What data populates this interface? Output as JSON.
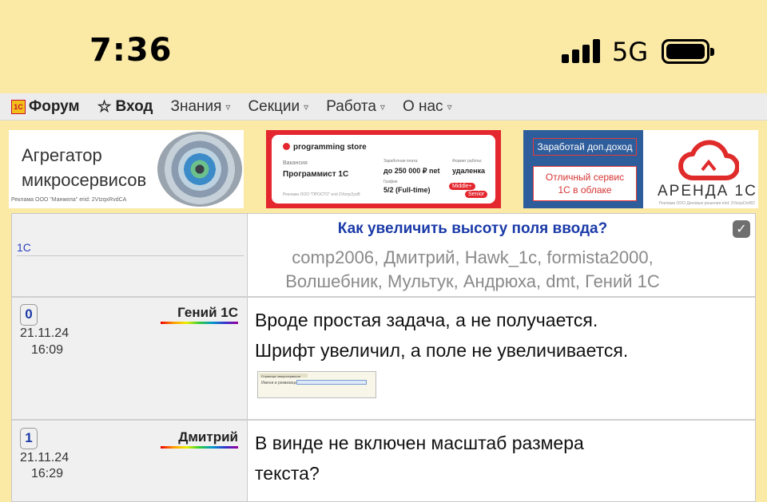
{
  "status_bar": {
    "time": "7:36",
    "network": "5G"
  },
  "nav": {
    "items": [
      {
        "label": "Форум",
        "icon": "1c-logo-icon"
      },
      {
        "label": "Вход",
        "icon": "star-icon"
      },
      {
        "label": "Знания",
        "icon": "caret-down-icon"
      },
      {
        "label": "Секции",
        "icon": "caret-down-icon"
      },
      {
        "label": "Работа",
        "icon": "caret-down-icon"
      },
      {
        "label": "О нас",
        "icon": "caret-down-icon"
      }
    ],
    "caret": "▿"
  },
  "ads": {
    "ad1": {
      "line1": "Агрегатор",
      "line2": "микросервисов",
      "disclaimer": "Реклама ООО \"Манжела\"    erid: 2VtzqxRvdCA"
    },
    "ad2": {
      "store": "programming store",
      "vacancy_label": "Вакансия",
      "vacancy": "Программист 1С",
      "salary_label": "Заработная плата:",
      "salary": "до 250 000 ₽ net",
      "format_label": "Формат работы:",
      "format": "удаленка",
      "schedule_label": "График:",
      "schedule": "5/2 (Full-time)",
      "tag1": "Middle+",
      "tag2": "Senior",
      "disclaimer": "Реклама ООО \"ПРОСТО\" erid 2Vtzqv2yoB"
    },
    "ad3": {
      "button1": "Заработай доп.доход",
      "button2_line1": "Отличный сервис",
      "button2_line2": "1С в облаке",
      "brand": "АРЕНДА 1С",
      "disclaimer": "Реклама ООО Деловые решения erid: 2VtzqvDctRD"
    }
  },
  "topic": {
    "section": "1С",
    "title": "Как увеличить высоту поля ввода?",
    "participants_line1": "comp2006, Дмитрий, Hawk_1c, formista2000,",
    "participants_line2": "Волшебник, Мультук, Андрюха, dmt, Гений 1С"
  },
  "posts": [
    {
      "number": "0",
      "author": "Гений 1С",
      "date": "21.11.24",
      "time": "16:09",
      "line1": "Вроде простая задача, а не получается.",
      "line2": "Шрифт увеличил, а поле не увеличивается.",
      "thumb_title": "Страница: микросервисов",
      "thumb_label": "Имени и реквизиции"
    },
    {
      "number": "1",
      "author": "Дмитрий",
      "date": "21.11.24",
      "time": "16:29",
      "line1": "В винде не включен масштаб размера",
      "line2": "текста?"
    }
  ],
  "colors": {
    "page_bg": "#fbeaa6",
    "link_blue": "#1a3aa8",
    "brand_red": "#e4262f"
  }
}
